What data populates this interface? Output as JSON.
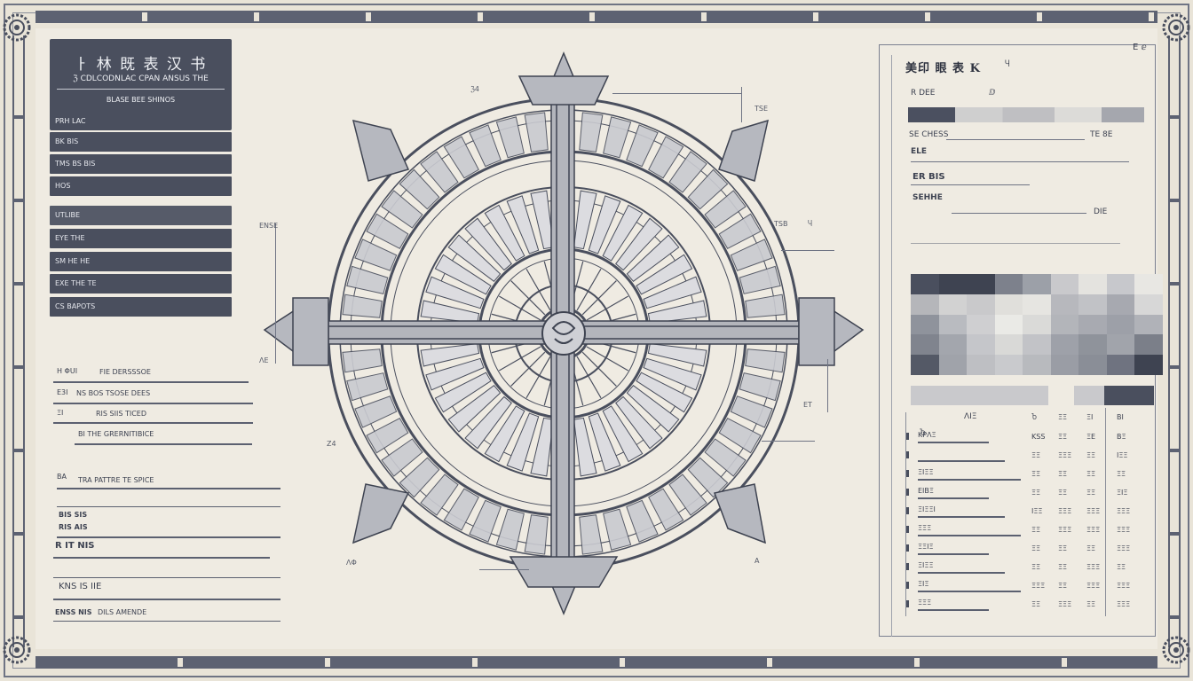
{
  "left_panel": {
    "title": "ㅏ 林 既 表 汉 书",
    "subtitle": "ℨ CDLCODNLAC CPAN ANSUS THE",
    "subtitle2": "BLASE BEE SHINOS",
    "stub": "PRH LAC",
    "menu": [
      {
        "label": "BK BIS"
      },
      {
        "label": "TMS BS BIS"
      },
      {
        "label": "HOS"
      },
      {
        "label": "UTLIBE"
      },
      {
        "label": "EYE THE"
      },
      {
        "label": "SM HE HE"
      },
      {
        "label": "EXE THE TE"
      },
      {
        "label": "CS BAPOTS"
      }
    ],
    "fields_a": [
      {
        "key": "H ΦUΙ",
        "value": "FIE DERSSSOE"
      },
      {
        "key": "E3I",
        "value": "NS BOS TSOSE DEES"
      },
      {
        "key": "ΞΙ",
        "value": "RIS SIIS TICED"
      },
      {
        "key": "",
        "value": "BI THE GRERNITIBICE"
      }
    ],
    "fields_b": [
      {
        "key": "BA",
        "value": "TRA PATTRE TE SPICE"
      },
      {
        "key": "BIS SIS",
        "value": ""
      },
      {
        "key": "RIS AIS",
        "value": ""
      },
      {
        "key": "R IT NIS",
        "value": ""
      },
      {
        "key": "KNS IS IIE",
        "value": ""
      },
      {
        "key": "ENSS NIS",
        "value": "DILS AMENDE"
      }
    ]
  },
  "diagram": {
    "annotations": [
      "TSE",
      "ℨ4",
      "ENSE",
      "TSB",
      "Z4",
      "ET",
      "A",
      "ΛΦ",
      "ΛΕ",
      "Ⴗ"
    ]
  },
  "right_panel": {
    "title": "美印 眼 表 K",
    "tag": "Ⴗ",
    "corner_mark": "E ⅇ",
    "label_1": "R DEE",
    "label_1b": "ⅅ",
    "label_2": "SE CHESS",
    "label_2b": "TE 8E",
    "label_3": "ELE",
    "label_4": "ER BIS",
    "label_5": "SEHHE",
    "label_5b": "DIE",
    "label_6": "ΛIΞ",
    "label_6b": "Ⴆ",
    "table_header": [
      "Ⴆ",
      "ΞΞ",
      "ΞΙ",
      "ΒΙ"
    ],
    "table_rows": [
      {
        "label": "ΚΡΛΞ",
        "cols": [
          "KSS",
          "ΞΞ",
          "ΞE",
          "ΒΞ"
        ]
      },
      {
        "label": "",
        "cols": [
          "ΞΞ",
          "ΞΞΞ",
          "ΞΞ",
          "ΙΞΞ"
        ]
      },
      {
        "label": "ΞΙΞΞ",
        "cols": [
          "ΞΞ",
          "ΞΞ",
          "ΞΞ",
          "ΞΞ"
        ]
      },
      {
        "label": "ΕΙΒΞ",
        "cols": [
          "ΞΞ",
          "ΞΞ",
          "ΞΞ",
          "ΞΙΞ"
        ]
      },
      {
        "label": "ΞΙΞΞΙ",
        "cols": [
          "ΙΞΞ",
          "ΞΞΞ",
          "ΞΞΞ",
          "ΞΞΞ"
        ]
      },
      {
        "label": "ΞΞΞ",
        "cols": [
          "ΞΞ",
          "ΞΞΞ",
          "ΞΞΞ",
          "ΞΞΞ"
        ]
      },
      {
        "label": "ΞΞΙΞ",
        "cols": [
          "ΞΞ",
          "ΞΞ",
          "ΞΞ",
          "ΞΞΞ"
        ]
      },
      {
        "label": "ΞΙΞΞ",
        "cols": [
          "ΞΞ",
          "ΞΞ",
          "ΞΞΞ",
          "ΞΞ"
        ]
      },
      {
        "label": "ΞΙΞ",
        "cols": [
          "ΞΞΞ",
          "ΞΞ",
          "ΞΞΞ",
          "ΞΞΞ"
        ]
      },
      {
        "label": "ΞΞΞ",
        "cols": [
          "ΞΞ",
          "ΞΞΞ",
          "ΞΞ",
          "ΞΞΞ"
        ]
      }
    ],
    "swatches": [
      "#4a4f5e",
      "#3e4351",
      "#3e4351",
      "#7d818c",
      "#9ca0a8",
      "#c9c9cc",
      "#e4e3df",
      "#c7c8cc",
      "#e8e7e3",
      "#b5b6ba",
      "#d2d2d2",
      "#c9c9cb",
      "#e0dfdb",
      "#e6e5e1",
      "#b7b8bd",
      "#c1c2c6",
      "#a7a9b0",
      "#d7d7d7",
      "#8f939c",
      "#b9bbc0",
      "#cfcfd1",
      "#eaeae6",
      "#dadad8",
      "#b3b5ba",
      "#a8aab1",
      "#9da0a8",
      "#b0b2b8",
      "#80848e",
      "#a3a6ad",
      "#c5c6ca",
      "#d9d9d7",
      "#c2c3c7",
      "#9ea1a9",
      "#8f939b",
      "#a1a4ab",
      "#7b7f89",
      "#545966",
      "#a0a3aa",
      "#bebfc3",
      "#c9cacd",
      "#b8babe",
      "#9a9da5",
      "#8a8e97",
      "#6f7380",
      "#3e4351"
    ]
  }
}
